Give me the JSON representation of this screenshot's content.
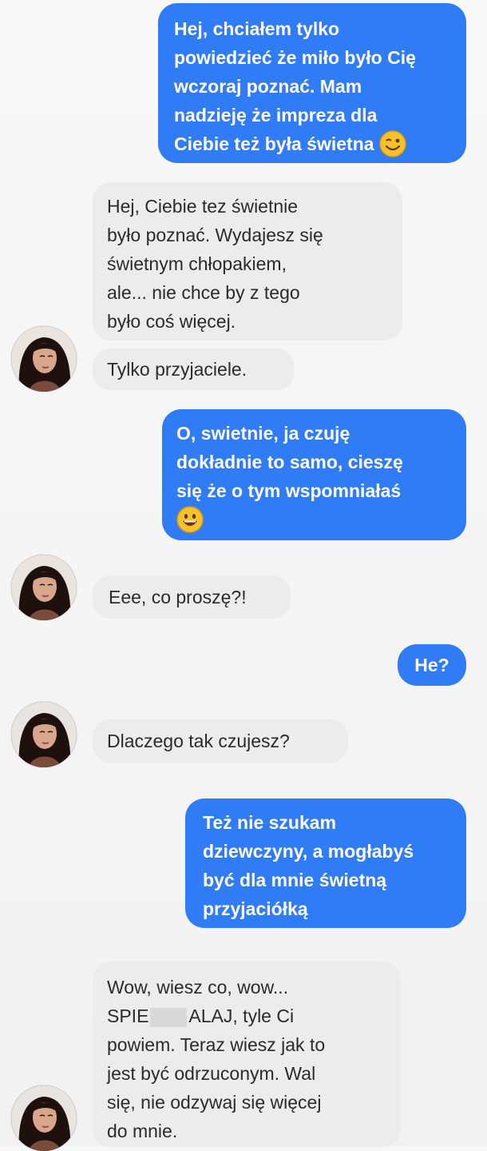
{
  "conversation": {
    "messages": [
      {
        "side": "outgoing",
        "lines": [
          "Hej, chciałem tylko",
          "powiedzieć że miło było Cię",
          "wczoraj poznać. Mam",
          "nadzieję że impreza dla",
          "Ciebie też była świetna"
        ],
        "emoji": "wink-smiley-icon"
      },
      {
        "side": "incoming",
        "lines": [
          "Hej, Ciebie tez świetnie",
          "było poznać. Wydajesz się",
          "świetnym chłopakiem,",
          "ale... nie chce by z tego",
          "było coś więcej."
        ]
      },
      {
        "side": "incoming",
        "lines": [
          "Tylko przyjaciele."
        ]
      },
      {
        "side": "outgoing",
        "lines": [
          "O, swietnie, ja czuję",
          "dokładnie to samo, cieszę",
          "się że o tym wspomniałaś"
        ],
        "emoji": "grinning-smiley-icon"
      },
      {
        "side": "incoming",
        "lines": [
          "Eee, co proszę?!"
        ]
      },
      {
        "side": "outgoing",
        "lines": [
          "He?"
        ]
      },
      {
        "side": "incoming",
        "lines": [
          "Dlaczego tak czujesz?"
        ]
      },
      {
        "side": "outgoing",
        "lines": [
          "Też nie szukam",
          "dziewczyny, a mogłabyś",
          "być dla mnie świetną",
          "przyjaciółką"
        ]
      },
      {
        "side": "incoming",
        "lines": [
          "Wow, wiesz co, wow...",
          "SPIE",
          "ALAJ, tyle Ci",
          "powiem. Teraz wiesz jak to",
          "jest być odrzuconym. Wal",
          "się, nie odzywaj się więcej",
          "do mnie."
        ]
      }
    ]
  },
  "colors": {
    "outgoing_bubble": "#2f7cf6",
    "incoming_bubble": "#ececec",
    "background": "#f7f7f7"
  }
}
